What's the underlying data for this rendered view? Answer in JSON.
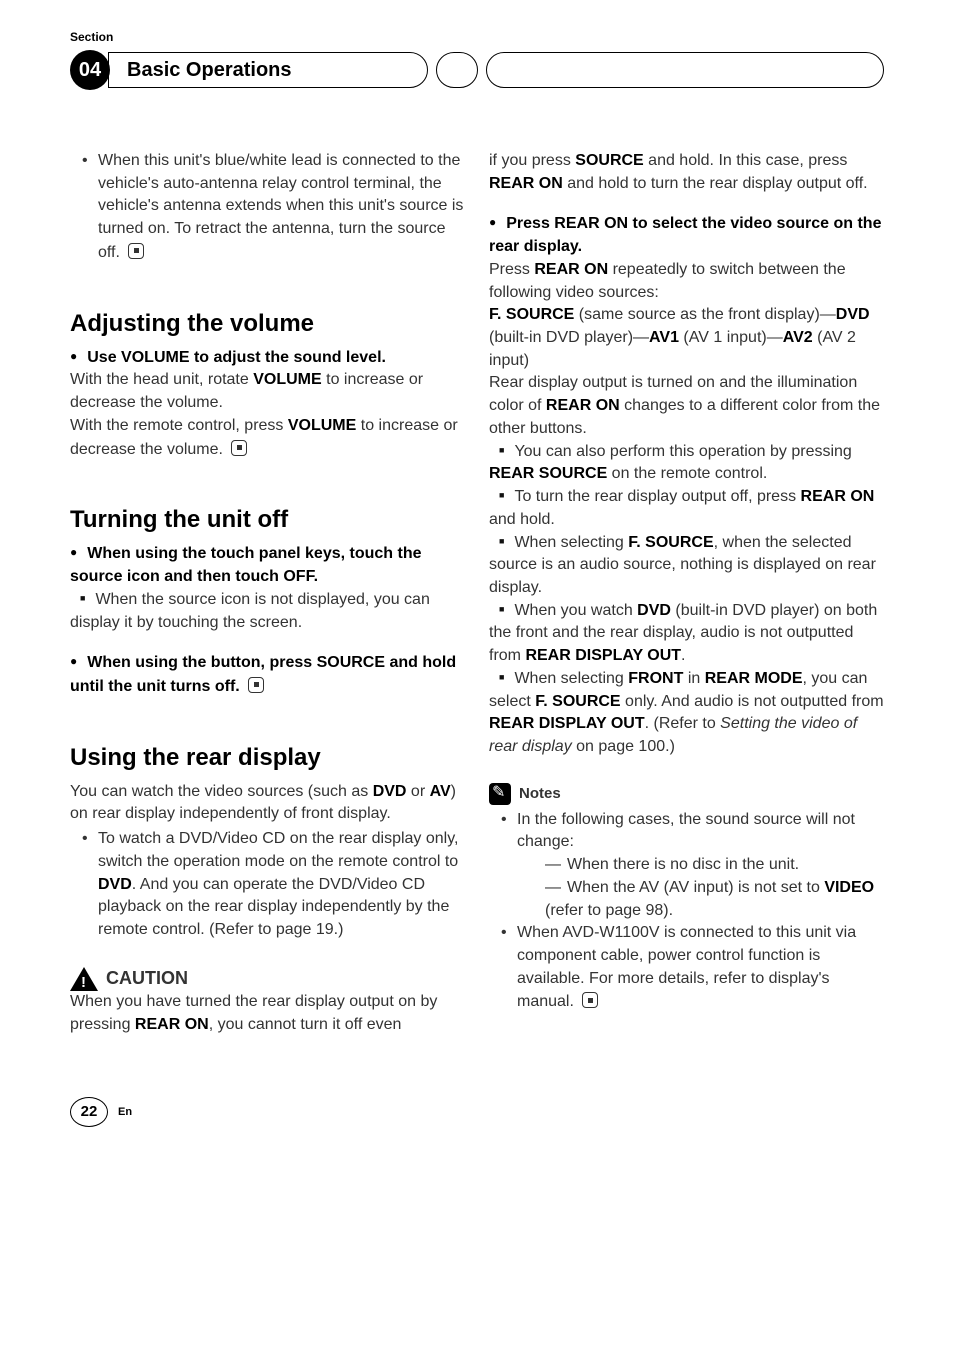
{
  "header": {
    "section_label": "Section",
    "section_number": "04",
    "chapter_title": "Basic Operations"
  },
  "left": {
    "bullet_intro": "When this unit's blue/white lead is connected to the vehicle's auto-antenna relay control terminal, the vehicle's antenna extends when this unit's source is turned on. To retract the antenna, turn the source off.",
    "h_volume": "Adjusting the volume",
    "vol_lead": "Use VOLUME to adjust the sound level.",
    "vol_p1a": "With the head unit, rotate ",
    "vol_p1b": "VOLUME",
    "vol_p1c": " to increase or decrease the volume.",
    "vol_p2a": "With the remote control, press ",
    "vol_p2b": "VOLUME",
    "vol_p2c": " to increase or decrease the volume.",
    "h_off": "Turning the unit off",
    "off_lead1": "When using the touch panel keys, touch the source icon and then touch OFF.",
    "off_sq1": "When the source icon is not displayed, you can display it by touching the screen.",
    "off_lead2": "When using the button, press SOURCE and hold until the unit turns off.",
    "h_rear": "Using the rear display",
    "rear_p1a": "You can watch the video sources (such as ",
    "rear_p1b": "DVD",
    "rear_p1c": " or ",
    "rear_p1d": "AV",
    "rear_p1e": ") on rear display independently of front display.",
    "rear_b1a": "To watch a DVD/Video CD on the rear display only, switch the operation mode on the remote control to ",
    "rear_b1b": "DVD",
    "rear_b1c": ". And you can operate the DVD/Video CD playback on the rear display independently by the remote control. (Refer to page 19.)",
    "caution_label": "CAUTION",
    "caution_p1a": "When you have turned the rear display output on by pressing ",
    "caution_p1b": "REAR ON",
    "caution_p1c": ", you cannot turn it off even"
  },
  "right": {
    "cont_a": "if you press ",
    "cont_b": "SOURCE",
    "cont_c": " and hold. In this case, press ",
    "cont_d": "REAR ON",
    "cont_e": " and hold to turn the rear display output off.",
    "lead2": "Press REAR ON to select the video source on the rear display.",
    "p2a": "Press ",
    "p2b": "REAR ON",
    "p2c": " repeatedly to switch between the following video sources:",
    "p3a": "F. SOURCE",
    "p3b": " (same source as the front display)—",
    "p3c": "DVD",
    "p3d": " (built-in DVD player)—",
    "p3e": "AV1",
    "p3f": " (AV 1 input)—",
    "p3g": "AV2",
    "p3h": " (AV 2 input)",
    "p4a": "Rear display output is turned on and the illumination color of ",
    "p4b": "REAR ON",
    "p4c": " changes to a different color from the other buttons.",
    "sq1a": "You can also perform this operation by pressing ",
    "sq1b": "REAR SOURCE",
    "sq1c": " on the remote control.",
    "sq2a": "To turn the rear display output off, press ",
    "sq2b": "REAR ON",
    "sq2c": " and hold.",
    "sq3a": "When selecting ",
    "sq3b": "F. SOURCE",
    "sq3c": ", when the selected source is an audio source, nothing is displayed on rear display.",
    "sq4a": "When you watch ",
    "sq4b": "DVD",
    "sq4c": " (built-in DVD player) on both the front and the rear display, audio is not outputted from ",
    "sq4d": "REAR DISPLAY OUT",
    "sq4e": ".",
    "sq5a": "When selecting ",
    "sq5b": "FRONT",
    "sq5c": " in ",
    "sq5d": "REAR MODE",
    "sq5e": ", you can select ",
    "sq5f": "F. SOURCE",
    "sq5g": " only. And audio is not outputted from ",
    "sq5h": "REAR DISPLAY OUT",
    "sq5i": ". (Refer to ",
    "sq5j": "Setting the video of rear display",
    "sq5k": " on page 100.)",
    "notes_label": "Notes",
    "n1": "In the following cases, the sound source will not change:",
    "n1a": "When there is no disc in the unit.",
    "n1b_a": "When the AV (AV input) is not set to ",
    "n1b_b": "VIDEO",
    "n1b_c": " (refer to page 98).",
    "n2": "When AVD-W1100V is connected to this unit via component cable, power control function is available. For more details, refer to display's manual."
  },
  "footer": {
    "page": "22",
    "lang": "En"
  }
}
